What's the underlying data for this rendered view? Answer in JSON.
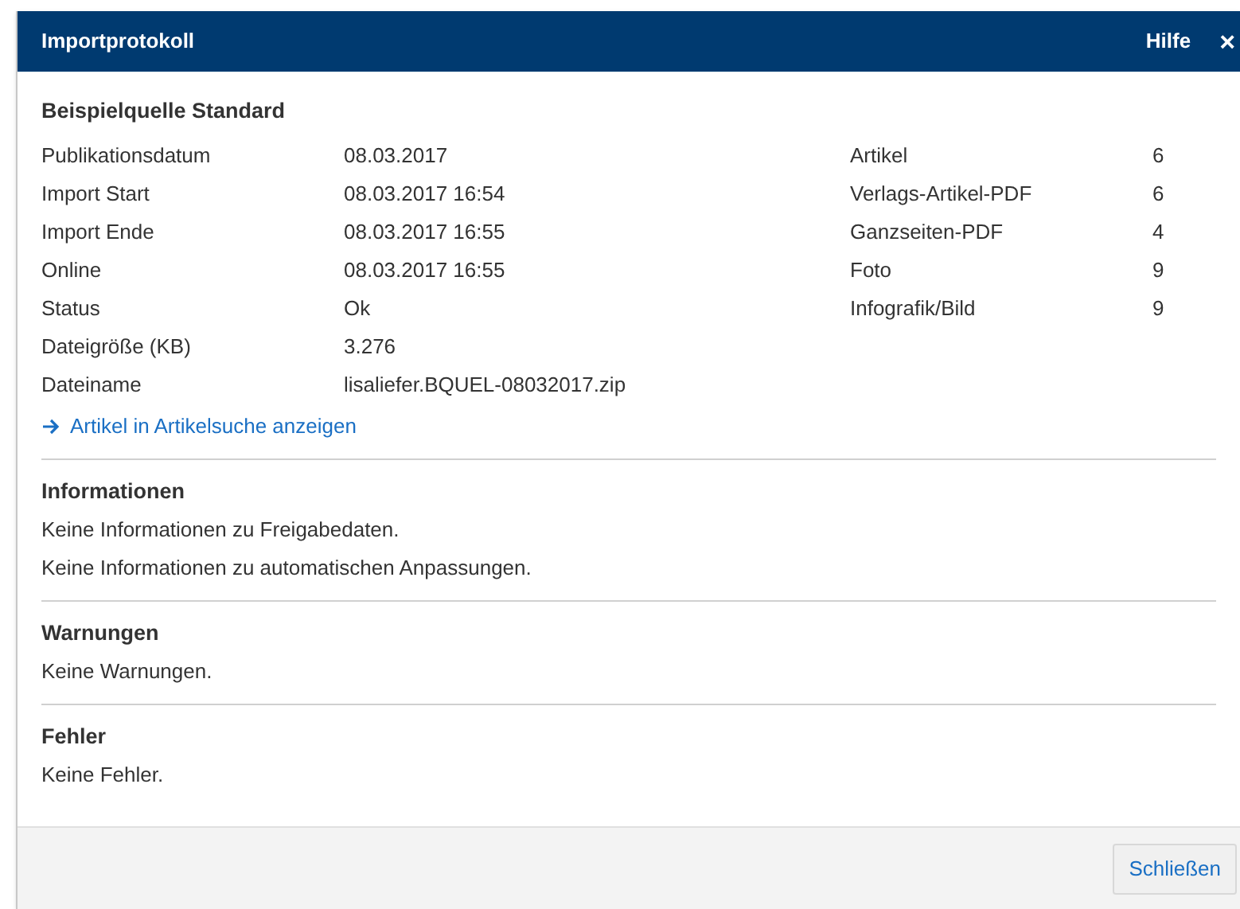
{
  "dialog": {
    "title": "Importprotokoll",
    "help": "Hilfe",
    "close": "×"
  },
  "source": {
    "title": "Beispielquelle Standard",
    "details": [
      {
        "label": "Publikationsdatum",
        "value": "08.03.2017"
      },
      {
        "label": "Import Start",
        "value": "08.03.2017 16:54"
      },
      {
        "label": "Import Ende",
        "value": "08.03.2017 16:55"
      },
      {
        "label": "Online",
        "value": "08.03.2017 16:55"
      },
      {
        "label": "Status",
        "value": "Ok"
      },
      {
        "label": "Dateigröße (KB)",
        "value": "3.276"
      },
      {
        "label": "Dateiname",
        "value": "lisaliefer.BQUEL-08032017.zip"
      }
    ],
    "counts": [
      {
        "label": "Artikel",
        "value": "6"
      },
      {
        "label": "Verlags-Artikel-PDF",
        "value": "6"
      },
      {
        "label": "Ganzseiten-PDF",
        "value": "4"
      },
      {
        "label": "Foto",
        "value": "9"
      },
      {
        "label": "Infografik/Bild",
        "value": "9"
      }
    ],
    "link": "Artikel in Artikelsuche anzeigen"
  },
  "sections": [
    {
      "title": "Informationen",
      "lines": [
        "Keine Informationen zu Freigabedaten.",
        "Keine Informationen zu automatischen Anpassungen."
      ]
    },
    {
      "title": "Warnungen",
      "lines": [
        "Keine Warnungen."
      ]
    },
    {
      "title": "Fehler",
      "lines": [
        "Keine Fehler."
      ]
    }
  ],
  "footer": {
    "button": "Schließen"
  }
}
